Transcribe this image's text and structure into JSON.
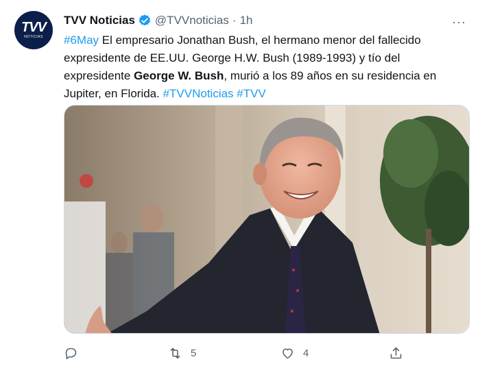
{
  "tweet": {
    "account": {
      "avatar_text": "TVV",
      "avatar_subtext": "NOTICIAS",
      "display_name": "TVV Noticias",
      "handle": "@TVVnoticias",
      "separator": "·",
      "time": "1h",
      "verified": true
    },
    "text": {
      "hashtag_date": "#6May",
      "part1": " El empresario Jonathan Bush, el hermano menor del fallecido expresidente de EE.UU. George H.W. Bush (1989-1993) y tío del expresidente ",
      "bold_name": "George W. Bush",
      "part2": ", murió a los 89 años en su residencia en Jupiter, en Florida. ",
      "hashtag_1": "#TVVNoticias",
      "hashtag_2": "#TVV"
    },
    "actions": {
      "retweet_count": "5",
      "like_count": "4"
    },
    "colors": {
      "link": "#1d9bf0",
      "muted": "#536471",
      "avatar_bg": "#0b1f4a"
    }
  }
}
